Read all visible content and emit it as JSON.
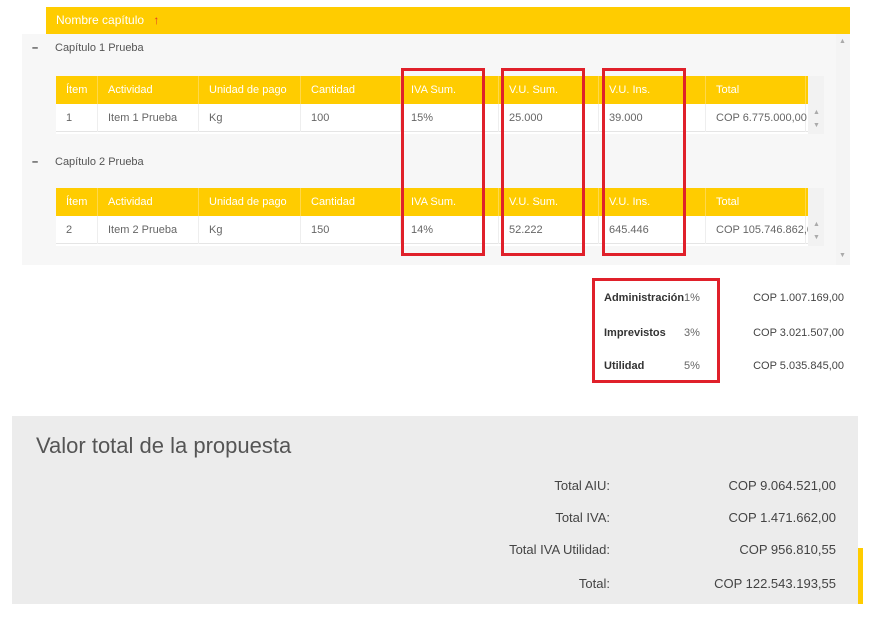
{
  "grid": {
    "header_label": "Nombre capítulo",
    "sort_icon": "↑",
    "columns": [
      "Ítem",
      "Actividad",
      "Unidad de pago",
      "Cantidad",
      "IVA Sum.",
      "V.U. Sum.",
      "V.U. Ins.",
      "Total"
    ],
    "groups": [
      {
        "toggle": "–",
        "title": "Capítulo 1 Prueba",
        "rows": [
          [
            "1",
            "Item 1 Prueba",
            "Kg",
            "100",
            "15%",
            "25.000",
            "39.000",
            "COP 6.775.000,00"
          ]
        ]
      },
      {
        "toggle": "–",
        "title": "Capítulo 2 Prueba",
        "rows": [
          [
            "2",
            "Item 2 Prueba",
            "Kg",
            "150",
            "14%",
            "52.222",
            "645.446",
            "COP 105.746.862,00"
          ]
        ]
      }
    ]
  },
  "aiu": [
    {
      "label": "Administración",
      "percent": "1%",
      "value": "COP 1.007.169,00"
    },
    {
      "label": "Imprevistos",
      "percent": "3%",
      "value": "COP 3.021.507,00"
    },
    {
      "label": "Utilidad",
      "percent": "5%",
      "value": "COP 5.035.845,00"
    }
  ],
  "summary": {
    "title": "Valor total de la propuesta",
    "rows": [
      {
        "label": "Total AIU:",
        "value": "COP 9.064.521,00"
      },
      {
        "label": "Total IVA:",
        "value": "COP 1.471.662,00"
      },
      {
        "label": "Total IVA Utilidad:",
        "value": "COP 956.810,55"
      },
      {
        "label": "Total:",
        "value": "COP 122.543.193,55"
      }
    ]
  },
  "colors": {
    "accent": "#ffcc00",
    "highlight": "#e0202a",
    "panel": "#ececec"
  }
}
